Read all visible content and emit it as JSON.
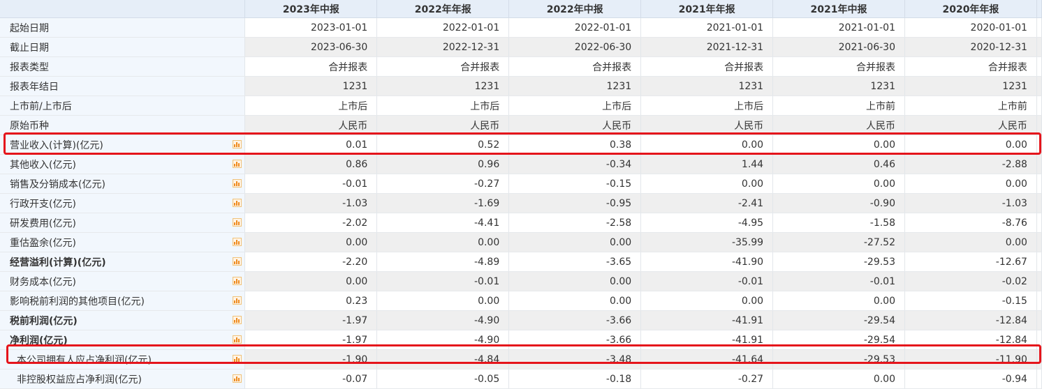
{
  "highlight_color": "#e5141b",
  "columns": [
    "2023年中报",
    "2022年年报",
    "2022年中报",
    "2021年年报",
    "2021年中报",
    "2020年年报"
  ],
  "rows": [
    {
      "label": "起始日期",
      "values": [
        "2023-01-01",
        "2022-01-01",
        "2022-01-01",
        "2021-01-01",
        "2021-01-01",
        "2020-01-01"
      ]
    },
    {
      "label": "截止日期",
      "values": [
        "2023-06-30",
        "2022-12-31",
        "2022-06-30",
        "2021-12-31",
        "2021-06-30",
        "2020-12-31"
      ]
    },
    {
      "label": "报表类型",
      "values": [
        "合并报表",
        "合并报表",
        "合并报表",
        "合并报表",
        "合并报表",
        "合并报表"
      ]
    },
    {
      "label": "报表年结日",
      "values": [
        "1231",
        "1231",
        "1231",
        "1231",
        "1231",
        "1231"
      ]
    },
    {
      "label": "上市前/上市后",
      "values": [
        "上市后",
        "上市后",
        "上市后",
        "上市后",
        "上市前",
        "上市前"
      ]
    },
    {
      "label": "原始币种",
      "values": [
        "人民币",
        "人民币",
        "人民币",
        "人民币",
        "人民币",
        "人民币"
      ]
    },
    {
      "label": "营业收入(计算)(亿元)",
      "values": [
        "0.01",
        "0.52",
        "0.38",
        "0.00",
        "0.00",
        "0.00"
      ],
      "chart": true,
      "highlighted": true
    },
    {
      "label": "其他收入(亿元)",
      "values": [
        "0.86",
        "0.96",
        "-0.34",
        "1.44",
        "0.46",
        "-2.88"
      ],
      "chart": true
    },
    {
      "label": "销售及分销成本(亿元)",
      "values": [
        "-0.01",
        "-0.27",
        "-0.15",
        "0.00",
        "0.00",
        "0.00"
      ],
      "chart": true
    },
    {
      "label": "行政开支(亿元)",
      "values": [
        "-1.03",
        "-1.69",
        "-0.95",
        "-2.41",
        "-0.90",
        "-1.03"
      ],
      "chart": true
    },
    {
      "label": "研发费用(亿元)",
      "values": [
        "-2.02",
        "-4.41",
        "-2.58",
        "-4.95",
        "-1.58",
        "-8.76"
      ],
      "chart": true
    },
    {
      "label": "重估盈余(亿元)",
      "values": [
        "0.00",
        "0.00",
        "0.00",
        "-35.99",
        "-27.52",
        "0.00"
      ],
      "chart": true
    },
    {
      "label": "经营溢利(计算)(亿元)",
      "values": [
        "-2.20",
        "-4.89",
        "-3.65",
        "-41.90",
        "-29.53",
        "-12.67"
      ],
      "chart": true,
      "bold": true
    },
    {
      "label": "财务成本(亿元)",
      "values": [
        "0.00",
        "-0.01",
        "0.00",
        "-0.01",
        "-0.01",
        "-0.02"
      ],
      "chart": true
    },
    {
      "label": "影响税前利润的其他项目(亿元)",
      "values": [
        "0.23",
        "0.00",
        "0.00",
        "0.00",
        "0.00",
        "-0.15"
      ],
      "chart": true
    },
    {
      "label": "税前利润(亿元)",
      "values": [
        "-1.97",
        "-4.90",
        "-3.66",
        "-41.91",
        "-29.54",
        "-12.84"
      ],
      "chart": true,
      "bold": true
    },
    {
      "label": "净利润(亿元)",
      "values": [
        "-1.97",
        "-4.90",
        "-3.66",
        "-41.91",
        "-29.54",
        "-12.84"
      ],
      "chart": true,
      "bold": true
    },
    {
      "label": "本公司拥有人应占净利润(亿元)",
      "values": [
        "-1.90",
        "-4.84",
        "-3.48",
        "-41.64",
        "-29.53",
        "-11.90"
      ],
      "chart": true,
      "indent": true,
      "highlighted": true
    },
    {
      "label": "非控股权益应占净利润(亿元)",
      "values": [
        "-0.07",
        "-0.05",
        "-0.18",
        "-0.27",
        "0.00",
        "-0.94"
      ],
      "chart": true,
      "indent": true
    }
  ]
}
